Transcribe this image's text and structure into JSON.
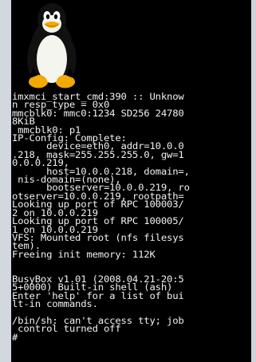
{
  "console": {
    "lines": [
      "imxmci_start_cmd:390 :: Unknow",
      "n resp_type = 0x0",
      "mmcblk0: mmc0:1234 SD256 24780",
      "8KiB",
      " mmcblk0: p1",
      "IP-Config: Complete:",
      "      device=eth0, addr=10.0.0",
      ".218, mask=255.255.255.0, gw=1",
      "0.0.0.219,",
      "      host=10.0.0.218, domain=,",
      " nis-domain=(none),",
      "      bootserver=10.0.0.219, ro",
      "otserver=10.0.0.219, rootpath=",
      "Looking up port of RPC 100003/",
      "2 on 10.0.0.219",
      "Looking up port of RPC 100005/",
      "1 on 10.0.0.219",
      "VFS: Mounted root (nfs filesys",
      "tem).",
      "Freeing init memory: 112K",
      "",
      "",
      "BusyBox v1.01 (2008.04.21-20:5",
      "5+0000) Built-in shell (ash)",
      "Enter 'help' for a list of bui",
      "lt-in commands.",
      "",
      "/bin/sh: can't access tty; job",
      " control turned off",
      "#"
    ]
  },
  "colors": {
    "screen_bg": "#000000",
    "text": "#f0f0f0",
    "frame": "#dfe3ea"
  },
  "logo": {
    "icon": "tux-penguin-icon"
  }
}
